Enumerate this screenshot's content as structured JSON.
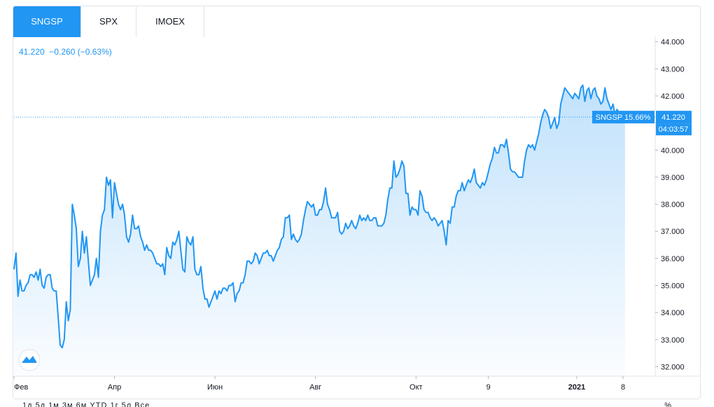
{
  "tabs": [
    {
      "label": "SNGSP",
      "active": true
    },
    {
      "label": "SPX",
      "active": false
    },
    {
      "label": "IMOEX",
      "active": false
    }
  ],
  "quote_line": "41.220  −0.260 (−0.63%)",
  "last_price_label": "41.220",
  "symbol_change_label": "SNGSP 15.66%",
  "countdown_label": "04:03:57",
  "footer_text": "1д  5д  1м  3м  6м  YTD  1г  5л  Все",
  "footer_pct": "%",
  "colors": {
    "line": "#2196f3",
    "accent": "#2196f3",
    "tab_active_bg": "#2196f3"
  },
  "icons": {
    "logo": "tradingview-logo-icon"
  },
  "chart_data": {
    "type": "area",
    "symbol": "SNGSP",
    "x_tick_labels": [
      "Фев",
      "Апр",
      "Июн",
      "Авг",
      "Окт",
      "9",
      "2021",
      "8"
    ],
    "y_tick_labels": [
      "44.000",
      "43.000",
      "42.000",
      "41.000",
      "40.000",
      "39.000",
      "38.000",
      "37.000",
      "36.000",
      "35.000",
      "34.000",
      "33.000",
      "32.000"
    ],
    "ylim": [
      31.65,
      44.2
    ],
    "y_ticks": [
      44,
      43,
      42,
      41,
      40,
      39,
      38,
      37,
      36,
      35,
      34,
      33,
      32
    ],
    "x_ticks": [
      0,
      50,
      100,
      150,
      200,
      236,
      280,
      303
    ],
    "xlim": [
      0,
      319
    ],
    "last_value": 41.22,
    "grid": false,
    "y": [
      35.6,
      36.2,
      34.6,
      35.2,
      34.8,
      34.8,
      35.0,
      35.1,
      35.4,
      35.4,
      35.3,
      35.5,
      35.2,
      35.6,
      35.0,
      34.9,
      35.3,
      35.4,
      35.4,
      34.9,
      34.8,
      34.8,
      33.8,
      32.8,
      32.7,
      33.0,
      34.4,
      33.7,
      34.1,
      38.0,
      37.6,
      37.1,
      35.7,
      36.0,
      37.0,
      36.2,
      36.8,
      35.9,
      35.0,
      35.2,
      35.4,
      36.0,
      35.3,
      37.0,
      37.6,
      37.8,
      39.0,
      38.7,
      38.9,
      37.5,
      38.8,
      38.4,
      38.0,
      37.8,
      38.0,
      37.6,
      36.8,
      36.6,
      36.9,
      37.6,
      37.1,
      37.1,
      37.2,
      36.8,
      36.6,
      36.3,
      36.5,
      36.3,
      36.3,
      36.2,
      36.0,
      35.8,
      35.8,
      35.7,
      35.8,
      35.4,
      36.4,
      36.1,
      36.0,
      36.6,
      36.5,
      36.7,
      37.0,
      36.3,
      35.6,
      35.5,
      36.8,
      36.6,
      36.5,
      36.8,
      35.6,
      35.4,
      35.4,
      35.7,
      34.9,
      34.5,
      34.5,
      34.2,
      34.4,
      34.6,
      34.8,
      34.5,
      34.8,
      34.7,
      34.9,
      34.9,
      34.8,
      35.0,
      35.0,
      35.1,
      34.4,
      34.7,
      34.8,
      35.1,
      35.1,
      35.4,
      35.9,
      35.9,
      35.8,
      35.9,
      36.2,
      36.1,
      35.8,
      36.0,
      36.2,
      36.2,
      36.3,
      36.1,
      36.1,
      35.9,
      36.1,
      36.3,
      36.4,
      36.7,
      36.8,
      37.5,
      37.5,
      37.6,
      36.7,
      36.9,
      36.7,
      36.6,
      36.7,
      36.9,
      37.4,
      37.8,
      38.1,
      38.0,
      37.9,
      38.0,
      37.6,
      37.6,
      37.8,
      37.8,
      38.1,
      38.6,
      38.0,
      37.8,
      37.5,
      37.5,
      37.5,
      37.7,
      37.0,
      36.9,
      37.0,
      37.3,
      37.1,
      37.2,
      37.4,
      37.2,
      37.1,
      37.3,
      37.6,
      37.4,
      37.5,
      37.4,
      37.6,
      37.4,
      37.4,
      37.5,
      37.5,
      37.2,
      37.2,
      37.2,
      37.3,
      37.6,
      38.2,
      38.6,
      38.6,
      39.6,
      39.0,
      39.1,
      39.3,
      39.6,
      39.4,
      38.4,
      38.4,
      37.6,
      37.9,
      37.8,
      37.8,
      37.6,
      38.5,
      38.3,
      37.8,
      37.7,
      37.7,
      37.5,
      37.4,
      37.5,
      37.4,
      37.2,
      37.3,
      37.4,
      37.0,
      36.5,
      37.4,
      37.3,
      37.9,
      37.9,
      38.3,
      38.5,
      38.5,
      38.8,
      38.5,
      38.7,
      38.9,
      38.8,
      39.0,
      39.3,
      38.8,
      38.7,
      38.6,
      38.8,
      38.7,
      38.9,
      39.2,
      39.5,
      39.7,
      40.1,
      39.9,
      39.9,
      40.2,
      40.2,
      40.1,
      40.4,
      39.9,
      39.3,
      39.2,
      39.2,
      39.1,
      39.0,
      39.0,
      39.0,
      39.6,
      40.0,
      40.2,
      40.1,
      40.2,
      40.0,
      40.3,
      40.6,
      41.0,
      41.3,
      41.5,
      41.4,
      41.2,
      40.8,
      41.0,
      41.2,
      40.8,
      41.0,
      41.7,
      42.0,
      42.3,
      42.2,
      42.1,
      42.0,
      41.9,
      42.1,
      42.0,
      41.9,
      42.3,
      42.4,
      41.8,
      42.2,
      42.3,
      41.9,
      42.2,
      42.3,
      42.0,
      41.9,
      41.7,
      41.8,
      42.3,
      41.9,
      41.7,
      41.5,
      41.7,
      41.3,
      41.5,
      41.4,
      41.3,
      41.2,
      41.22
    ]
  }
}
